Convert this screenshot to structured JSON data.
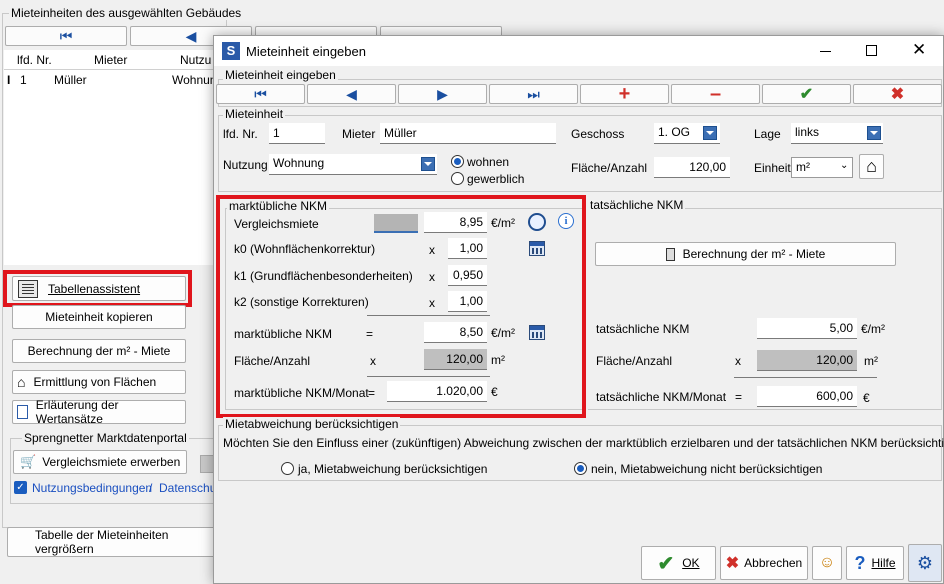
{
  "background": {
    "group_title": "Mieteinheiten des ausgewählten Gebäudes",
    "columns": [
      "lfd. Nr.",
      "Mieter",
      "Nutzu"
    ],
    "rows": [
      {
        "marker": "I",
        "nr": "1",
        "mieter": "Müller",
        "nutzung": "Wohnun"
      }
    ],
    "buttons": {
      "tabellenassistent": "Tabellenassistent",
      "kopieren": "Mieteinheit kopieren",
      "berechnung": "Berechnung der m² - Miete",
      "ermittlung": "Ermittlung von Flächen",
      "erlaeuterung": "Erläuterung der Wertansätze",
      "vergleichsmiete_erwerben": "Vergleichsmiete erwerben",
      "tabelle_vergroessern": "Tabelle der Mieteinheiten vergrößern"
    },
    "sprengnetter_title": "Sprengnetter Marktdatenportal",
    "nutzungsbedingungen": "Nutzungsbedingungen",
    "slash": "/",
    "datenschutz": "Datenschu"
  },
  "dialog": {
    "title": "Mieteinheit eingeben",
    "app_icon_letter": "S",
    "nav_group_title": "Mieteinheit eingeben",
    "section_mieteinheit": "Mieteinheit",
    "lfd_nr_label": "lfd. Nr.",
    "lfd_nr_value": "1",
    "mieter_label": "Mieter",
    "mieter_value": "Müller",
    "geschoss_label": "Geschoss",
    "geschoss_value": "1. OG",
    "lage_label": "Lage",
    "lage_value": "links",
    "nutzung_label": "Nutzung",
    "nutzung_value": "Wohnung",
    "radio_wohnen": "wohnen",
    "radio_gewerblich": "gewerblich",
    "flaeche_label": "Fläche/Anzahl",
    "flaeche_value": "120,00",
    "einheit_label": "Einheit",
    "einheit_value": "m²",
    "marktueblich": {
      "title": "marktübliche NKM",
      "vergleichsmiete_label": "Vergleichsmiete",
      "vergleichsmiete_value": "8,95",
      "unit_eur_m2": "€/m²",
      "k0_label": "k0  (Wohnflächenkorrektur)",
      "k0_value": "1,00",
      "k1_label": "k1  (Grundflächenbesonderheiten)",
      "k1_value": "0,950",
      "k2_label": "k2  (sonstige Korrekturen)",
      "k2_value": "1,00",
      "x": "x",
      "eq": "=",
      "nkm_label": "marktübliche NKM",
      "nkm_value": "8,50",
      "flaeche_label": "Fläche/Anzahl",
      "flaeche_value": "120,00",
      "unit_m2": "m²",
      "monat_label": "marktübliche NKM/Monat",
      "monat_value": "1.020,00",
      "unit_eur": "€"
    },
    "tatsaechlich": {
      "title": "tatsächliche NKM",
      "berechnung_button": "Berechnung der m² - Miete",
      "nkm_label": "tatsächliche NKM",
      "nkm_value": "5,00",
      "unit_eur_m2": "€/m²",
      "flaeche_label": "Fläche/Anzahl",
      "x": "x",
      "flaeche_value": "120,00",
      "unit_m2": "m²",
      "monat_label": "tatsächliche NKM/Monat",
      "eq": "=",
      "monat_value": "600,00",
      "unit_eur": "€"
    },
    "mietabweichung": {
      "title": "Mietabweichung berücksichtigen",
      "question": "Möchten Sie den Einfluss einer (zukünftigen) Abweichung zwischen der marktüblich erzielbaren und der tatsächlichen NKM berücksichtigen?",
      "option_ja": "ja, Mietabweichung berücksichtigen",
      "option_nein": "nein, Mietabweichung nicht berücksichtigen"
    },
    "footer": {
      "ok": "OK",
      "abbrechen": "Abbrechen",
      "hilfe": "Hilfe"
    }
  },
  "colors": {
    "highlight": "#e0151c",
    "accent": "#1a5dbf",
    "green": "#2e8b2e",
    "red": "#d0302a"
  }
}
